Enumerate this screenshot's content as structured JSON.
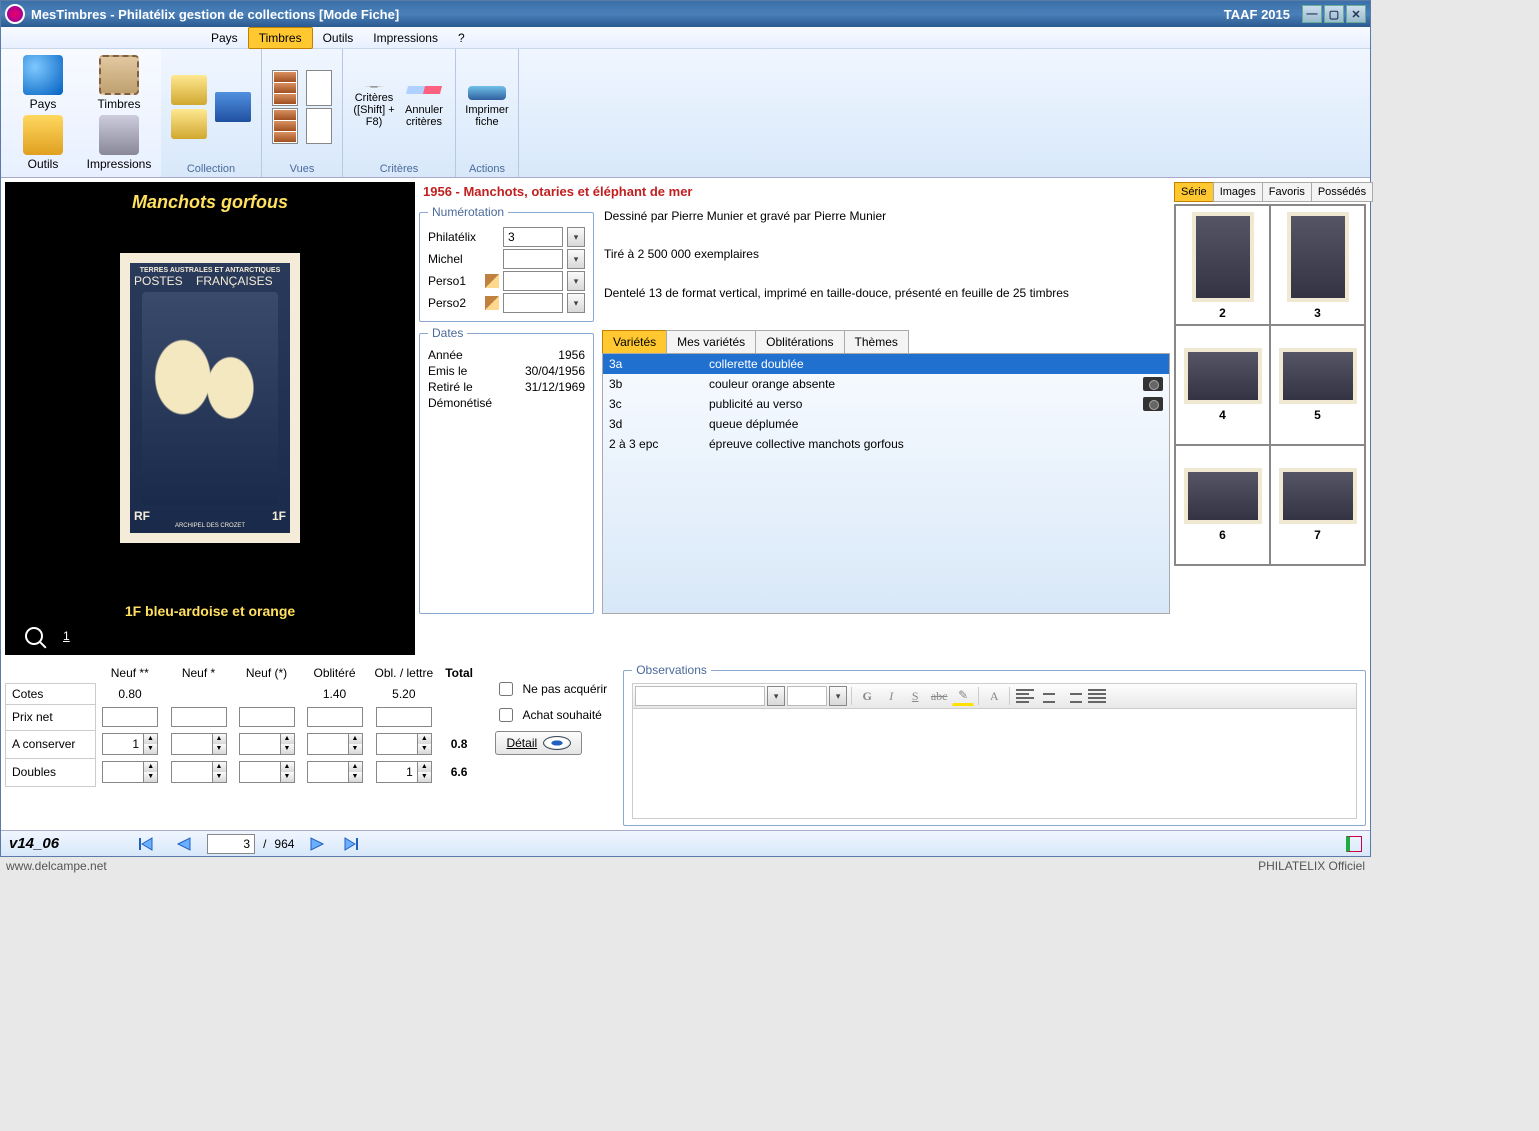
{
  "titlebar": {
    "app_title": "MesTimbres - Philatélix gestion de collections [Mode Fiche]",
    "right_title": "TAAF 2015"
  },
  "menubar": {
    "items": [
      "Pays",
      "Timbres",
      "Outils",
      "Impressions",
      "?"
    ],
    "active_index": 1
  },
  "sidebar_tools": {
    "items": [
      "Pays",
      "Timbres",
      "Outils",
      "Impressions"
    ]
  },
  "ribbon": {
    "collection": {
      "label": "Collection"
    },
    "vues": {
      "label": "Vues"
    },
    "criteres": {
      "label": "Critères",
      "criteres_btn": "Critères ([Shift] + F8)",
      "annuler_btn": "Annuler critères"
    },
    "actions": {
      "label": "Actions",
      "imprimer_btn": "Imprimer fiche"
    }
  },
  "stamp_preview": {
    "caption_top": "Manchots gorfous",
    "stamp_header": "TERRES AUSTRALES ET ANTARCTIQUES",
    "stamp_header2": "FRANÇAISES",
    "postes": "POSTES",
    "rf": "RF",
    "face_value": "1F",
    "archipel": "ARCHIPEL DES CROZET",
    "caption_bot": "1F bleu-ardoise et orange",
    "page_num": "1"
  },
  "series_title": "1956 - Manchots, otaries et éléphant de mer",
  "numerotation": {
    "legend": "Numérotation",
    "philatelix_label": "Philatélix",
    "philatelix_value": "3",
    "michel_label": "Michel",
    "michel_value": "",
    "perso1_label": "Perso1",
    "perso1_value": "",
    "perso2_label": "Perso2",
    "perso2_value": ""
  },
  "description": {
    "line1": "Dessiné par Pierre Munier et gravé par Pierre Munier",
    "line2": "Tiré à 2 500 000 exemplaires",
    "line3": "Dentelé 13 de format vertical, imprimé en taille-douce, présenté en feuille de 25 timbres"
  },
  "dates": {
    "legend": "Dates",
    "annee_label": "Année",
    "annee_value": "1956",
    "emis_label": "Emis le",
    "emis_value": "30/04/1956",
    "retire_label": "Retiré le",
    "retire_value": "31/12/1969",
    "demon_label": "Démonétisé",
    "demon_value": ""
  },
  "var_tabs": {
    "items": [
      "Variétés",
      "Mes variétés",
      "Oblitérations",
      "Thèmes"
    ],
    "active_index": 0
  },
  "varietes": [
    {
      "code": "3a",
      "desc": "collerette doublée",
      "selected": true,
      "camera": false
    },
    {
      "code": "3b",
      "desc": "couleur orange absente",
      "selected": false,
      "camera": true
    },
    {
      "code": "3c",
      "desc": "publicité au verso",
      "selected": false,
      "camera": true
    },
    {
      "code": "3d",
      "desc": "queue déplumée",
      "selected": false,
      "camera": false
    },
    {
      "code": "2 à 3 epc",
      "desc": "épreuve collective manchots gorfous",
      "selected": false,
      "camera": false
    }
  ],
  "right_tabs": {
    "items": [
      "Série",
      "Images",
      "Favoris",
      "Possédés"
    ],
    "active_index": 0
  },
  "thumbnails": [
    {
      "num": "2",
      "wide": false
    },
    {
      "num": "3",
      "wide": false
    },
    {
      "num": "4",
      "wide": true
    },
    {
      "num": "5",
      "wide": true
    },
    {
      "num": "6",
      "wide": true
    },
    {
      "num": "7",
      "wide": true
    }
  ],
  "quote_table": {
    "headers": [
      "",
      "Neuf **",
      "Neuf *",
      "Neuf (*)",
      "Oblitéré",
      "Obl. / lettre",
      "Total"
    ],
    "cotes_label": "Cotes",
    "cotes": [
      "0.80",
      "",
      "",
      "1.40",
      "5.20",
      ""
    ],
    "prixnet_label": "Prix net",
    "prixnet": [
      "",
      "",
      "",
      "",
      ""
    ],
    "aconserver_label": "A conserver",
    "aconserver": [
      "1",
      "",
      "",
      "",
      ""
    ],
    "aconserver_total": "0.8",
    "doubles_label": "Doubles",
    "doubles": [
      "",
      "",
      "",
      "",
      "1"
    ],
    "doubles_total": "6.6"
  },
  "checkboxes": {
    "ne_pas_acquerir": "Ne pas acquérir",
    "achat_souhaite": "Achat souhaité",
    "detail_btn": "Détail"
  },
  "observations": {
    "legend": "Observations"
  },
  "statusbar": {
    "version": "v14_06",
    "current": "3",
    "sep": "/",
    "total": "964"
  },
  "footer": {
    "left": "www.delcampe.net",
    "right": "PHILATELIX Officiel"
  }
}
